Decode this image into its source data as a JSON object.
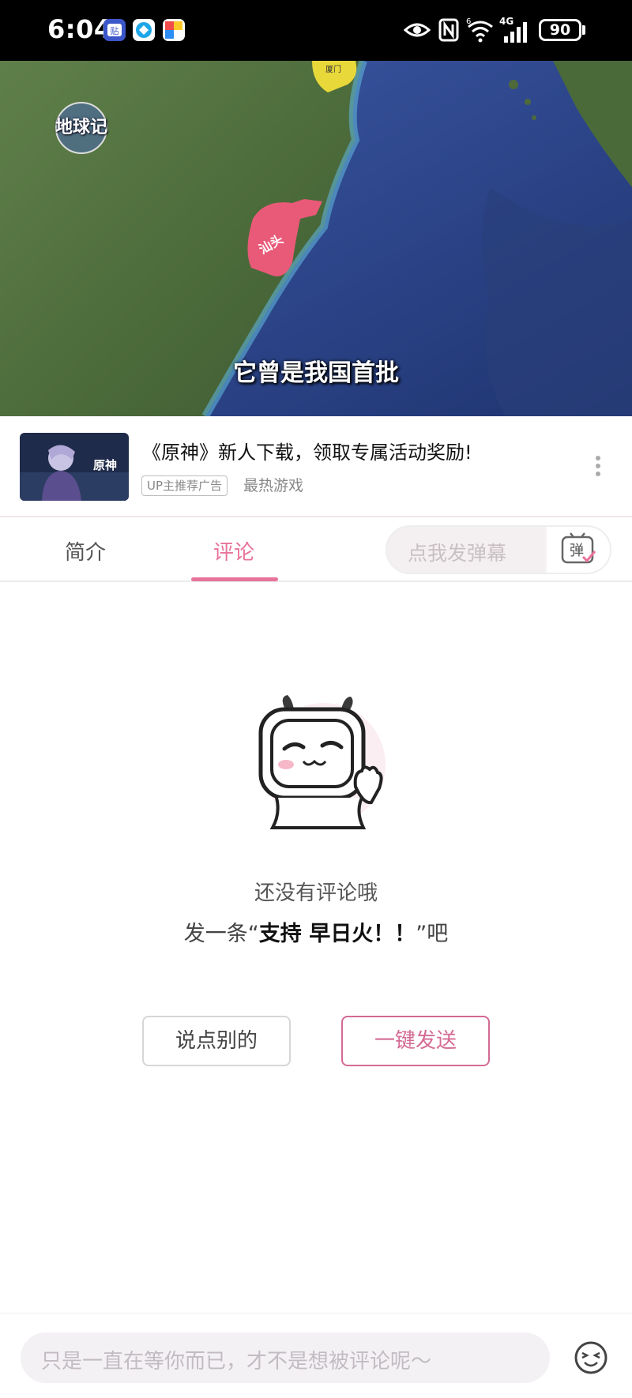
{
  "status_bar": {
    "time": "6:04",
    "battery": "90",
    "network": "4G",
    "icons": [
      "tieba-icon",
      "browser-icon",
      "puzzle-app-icon",
      "eye-icon",
      "nfc-icon",
      "wifi-icon",
      "signal-icon",
      "battery-icon"
    ]
  },
  "video": {
    "subtitle": "它曾是我国首批",
    "watermark": "地球记",
    "map_labels": [
      "汕头",
      "厦门"
    ],
    "highlight_color": "#e85a78",
    "secondary_highlight_color": "#e8d83a"
  },
  "ad": {
    "title": "《原神》新人下载，领取专属活动奖励!",
    "tag": "UP主推荐广告",
    "source": "最热游戏",
    "thumb_logo": "原神"
  },
  "tabs": {
    "items": [
      {
        "label": "简介",
        "active": false
      },
      {
        "label": "评论",
        "active": true
      }
    ],
    "danmaku_placeholder": "点我发弹幕",
    "danmaku_button": "弹",
    "accent_color": "#e8739a"
  },
  "empty_state": {
    "line1": "还没有评论哦",
    "line2_prefix": "发一条“",
    "line2_bold": "支持 早日火！！",
    "line2_suffix": "”吧",
    "button_other": "说点别的",
    "button_send": "一键发送"
  },
  "comment_bar": {
    "placeholder": "只是一直在等你而已，才不是想被评论呢～"
  }
}
